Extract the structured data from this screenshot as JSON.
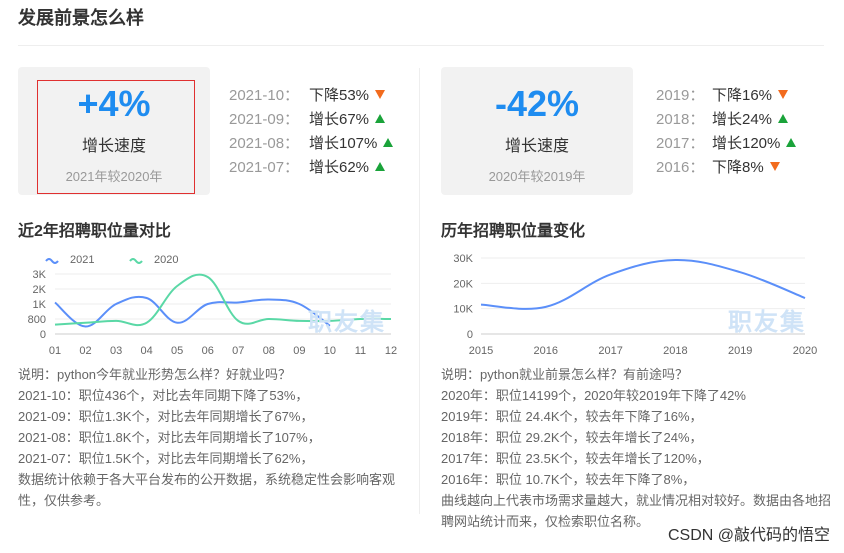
{
  "header": {
    "title": "发展前景怎么样"
  },
  "left": {
    "card": {
      "value": "+4%",
      "label": "增长速度",
      "sub": "2021年较2020年"
    },
    "stats": [
      {
        "period": "2021-10：",
        "text": "下降53%",
        "dir": "down"
      },
      {
        "period": "2021-09：",
        "text": "增长67%",
        "dir": "up"
      },
      {
        "period": "2021-08：",
        "text": "增长107%",
        "dir": "up"
      },
      {
        "period": "2021-07：",
        "text": "增长62%",
        "dir": "up"
      }
    ],
    "chart_title": "近2年招聘职位量对比",
    "watermark": "职友集",
    "description": [
      "说明：python今年就业形势怎么样？好就业吗？",
      "2021-10：职位436个，对比去年同期下降了53%，",
      "2021-09：职位1.3K个，对比去年同期增长了67%，",
      "2021-08：职位1.8K个，对比去年同期增长了107%，",
      "2021-07：职位1.5K个，对比去年同期增长了62%，",
      "数据统计依赖于各大平台发布的公开数据，系统稳定性会影响客观性，仅供参考。"
    ]
  },
  "right": {
    "card": {
      "value": "-42%",
      "label": "增长速度",
      "sub": "2020年较2019年"
    },
    "stats": [
      {
        "period": "2019：",
        "text": "下降16%",
        "dir": "down"
      },
      {
        "period": "2018：",
        "text": "增长24%",
        "dir": "up"
      },
      {
        "period": "2017：",
        "text": "增长120%",
        "dir": "up"
      },
      {
        "period": "2016：",
        "text": "下降8%",
        "dir": "down"
      }
    ],
    "chart_title": "历年招聘职位量变化",
    "watermark": "职友集",
    "description": [
      "说明：python就业前景怎么样？有前途吗？",
      "2020年：职位14199个，2020年较2019年下降了42%",
      "2019年：职位 24.4K个，较去年下降了16%，",
      "2018年：职位 29.2K个，较去年增长了24%，",
      "2017年：职位 23.5K个，较去年增长了120%，",
      "2016年：职位 10.7K个，较去年下降了8%，",
      "曲线越向上代表市场需求量越大，就业情况相对较好。数据由各地招聘网站统计而来，仅检索职位名称。"
    ]
  },
  "credit": "CSDN @敲代码的悟空",
  "chart_data": [
    {
      "type": "line",
      "categories": [
        "01",
        "02",
        "03",
        "04",
        "05",
        "06",
        "07",
        "08",
        "09",
        "10",
        "11",
        "12"
      ],
      "series": [
        {
          "name": "2021",
          "color": "#5b8ff9",
          "values": [
            1100,
            400,
            1000,
            1400,
            600,
            1000,
            1100,
            1300,
            1000,
            436,
            null,
            null
          ]
        },
        {
          "name": "2020",
          "color": "#5ad8a6",
          "values": [
            500,
            600,
            700,
            600,
            2200,
            2800,
            700,
            800,
            700,
            700,
            800,
            800
          ]
        }
      ],
      "yticks": [
        "0",
        "800",
        "1K",
        "2K",
        "3K"
      ],
      "ylim": [
        0,
        3000
      ],
      "grid": true,
      "legend": "top-left"
    },
    {
      "type": "line",
      "x": [
        "2015",
        "2016",
        "2017",
        "2018",
        "2019",
        "2020"
      ],
      "series": [
        {
          "color": "#5b8ff9",
          "values": [
            11600,
            10700,
            23500,
            29200,
            24400,
            14199
          ]
        }
      ],
      "yticks": [
        "0",
        "10K",
        "20K",
        "30K"
      ],
      "ylim": [
        0,
        30000
      ],
      "grid": true
    }
  ]
}
